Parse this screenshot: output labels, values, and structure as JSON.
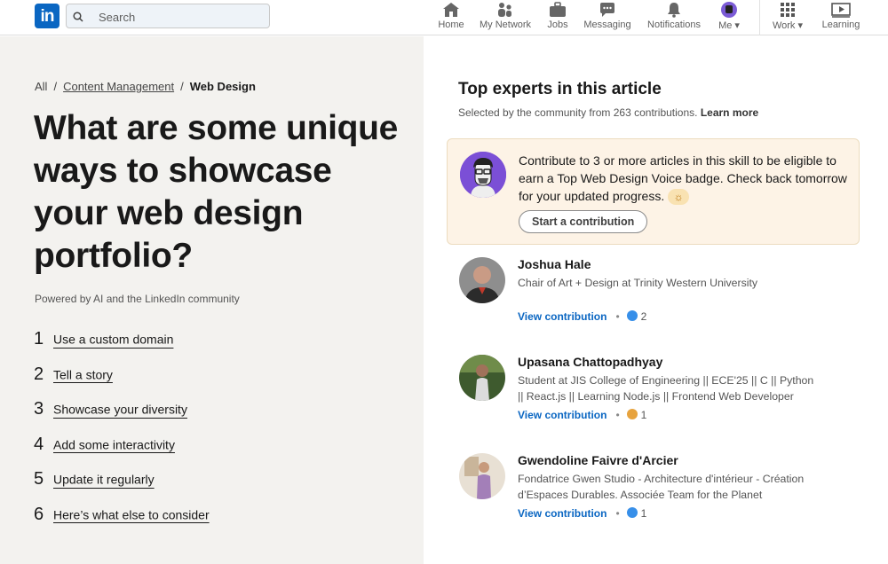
{
  "nav": {
    "search_placeholder": "Search",
    "items": [
      {
        "label": "Home"
      },
      {
        "label": "My Network"
      },
      {
        "label": "Jobs"
      },
      {
        "label": "Messaging"
      },
      {
        "label": "Notifications"
      },
      {
        "label": "Me"
      },
      {
        "label": "Work"
      },
      {
        "label": "Learning"
      }
    ],
    "colors": {
      "brand": "#0a66c2"
    }
  },
  "breadcrumb": {
    "all": "All",
    "category": "Content Management",
    "current": "Web Design"
  },
  "article": {
    "title": "What are some unique ways to showcase your web design portfolio?",
    "powered_by": "Powered by AI and the LinkedIn community",
    "toc": [
      {
        "num": "1",
        "label": "Use a custom domain"
      },
      {
        "num": "2",
        "label": "Tell a story"
      },
      {
        "num": "3",
        "label": "Showcase your diversity"
      },
      {
        "num": "4",
        "label": "Add some interactivity"
      },
      {
        "num": "5",
        "label": "Update it regularly"
      },
      {
        "num": "6",
        "label": "Here’s what else to consider"
      }
    ]
  },
  "experts": {
    "title": "Top experts in this article",
    "subtitle": "Selected by the community from 263 contributions.",
    "learn_more": "Learn more",
    "promo": {
      "text": "Contribute to 3 or more articles in this skill to be eligible to earn a Top Web Design Voice badge. Check back tomorrow for your updated progress.",
      "button": "Start a contribution"
    },
    "list": [
      {
        "name": "Joshua Hale",
        "headline": "Chair of Art + Design at Trinity Western University",
        "link": "View contribution",
        "count": "2"
      },
      {
        "name": "Upasana Chattopadhyay",
        "headline": "Student at JIS College of Engineering || ECE'25 || C || Python || React.js || Learning Node.js || Frontend Web Developer",
        "link": "View contribution",
        "count": "1"
      },
      {
        "name": "Gwendoline Faivre d'Arcier",
        "headline": "Fondatrice Gwen Studio - Architecture d'intérieur - Création d’Espaces Durables. Associée Team for the Planet",
        "link": "View contribution",
        "count": "1"
      }
    ]
  }
}
